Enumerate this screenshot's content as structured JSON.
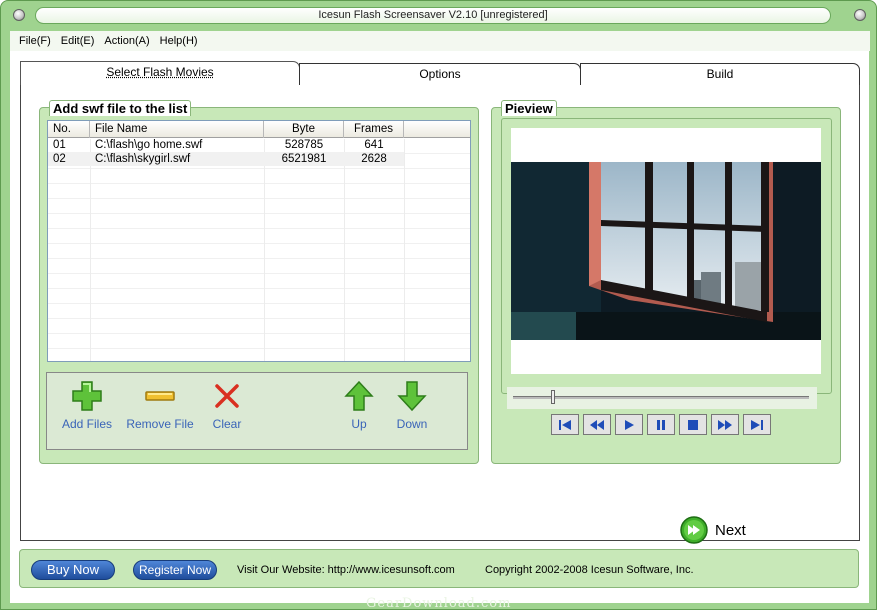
{
  "window": {
    "title": "Icesun Flash Screensaver V2.10 [unregistered]"
  },
  "menu": [
    "File(F)",
    "Edit(E)",
    "Action(A)",
    "Help(H)"
  ],
  "tabs": [
    "Select Flash Movies",
    "Options",
    "Build"
  ],
  "file_group": {
    "title": "Add swf file to the list",
    "columns": [
      "No.",
      "File Name",
      "Byte",
      "Frames"
    ],
    "rows": [
      {
        "no": "01",
        "name": "C:\\flash\\go home.swf",
        "byte": "528785",
        "frames": "641"
      },
      {
        "no": "02",
        "name": "C:\\flash\\skygirl.swf",
        "byte": "6521981",
        "frames": "2628"
      }
    ]
  },
  "toolbar": {
    "add": "Add Files",
    "remove": "Remove File",
    "clear": "Clear",
    "up": "Up",
    "down": "Down"
  },
  "preview": {
    "title": "Pieview",
    "seek_position": 0.13
  },
  "next_label": "Next",
  "status": {
    "buy": "Buy Now",
    "register": "Register Now",
    "website": "Visit Our Website: http://www.icesunsoft.com",
    "copyright": "Copyright 2002-2008 Icesun Software, Inc."
  },
  "watermark": "GearDownload.com",
  "colors": {
    "frame_green": "#9fd38f",
    "panel_green": "#c8e8b8",
    "accent_blue": "#1f4d9c"
  }
}
